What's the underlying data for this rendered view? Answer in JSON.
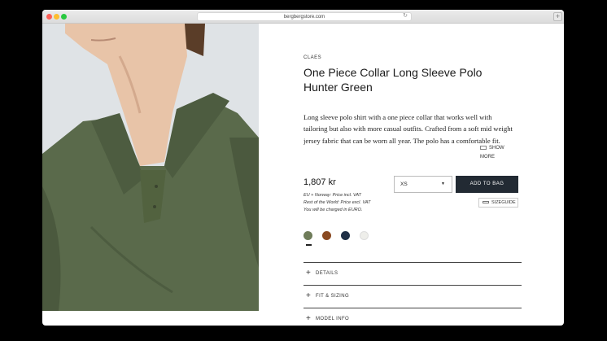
{
  "browser": {
    "url": "bergbergstore.com",
    "reload_icon": "reload-icon",
    "newtab_label": "+"
  },
  "product": {
    "brand": "CLAES",
    "title": "One Piece Collar Long Sleeve Polo Hunter Green",
    "description": "Long sleeve polo shirt with a one piece collar that works well with tailoring but also with more casual outfits. Crafted from a soft mid weight jersey fabric that can be worn all year. The polo has a comfortable fit.",
    "show_more": "SHOW MORE",
    "price": "1,807 kr",
    "price_notes": [
      "EU + Norway: Price incl. VAT",
      "Rest of the World: Price excl. VAT",
      "You will be charged in EURO."
    ],
    "size": {
      "selected": "XS",
      "caret": "▼"
    },
    "add_to_bag": "ADD TO BAG",
    "size_guide": "SIZEGUIDE",
    "swatches": [
      {
        "color": "#6f7c5a",
        "name": "green",
        "selected": true
      },
      {
        "color": "#8a4a22",
        "name": "brown"
      },
      {
        "color": "#1f2f45",
        "name": "navy"
      },
      {
        "color": "#eeeeea",
        "name": "white"
      }
    ],
    "accordions": [
      {
        "plus": "+",
        "label": "DETAILS"
      },
      {
        "plus": "+",
        "label": "FIT & SIZING"
      },
      {
        "plus": "+",
        "label": "MODEL INFO"
      }
    ]
  },
  "colors": {
    "shirt": "#5a6a4b",
    "button_bg": "#222a33"
  }
}
